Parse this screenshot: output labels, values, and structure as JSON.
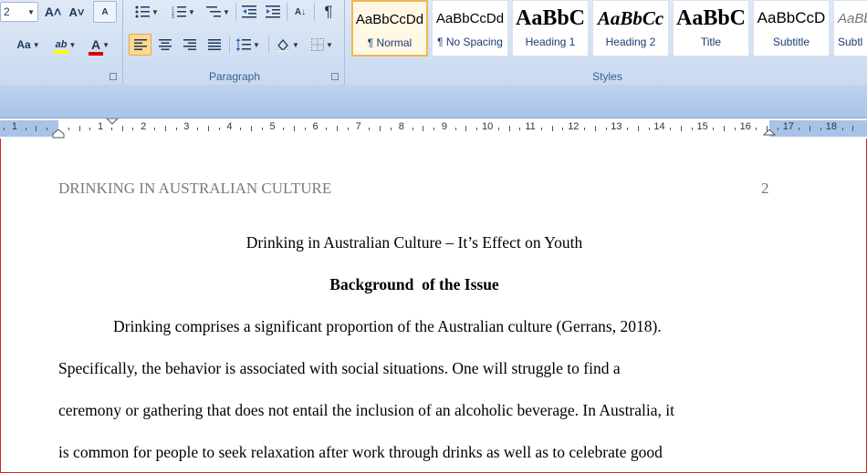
{
  "ribbon": {
    "font_size_value": "2",
    "paragraph_label": "Paragraph",
    "styles_label": "Styles",
    "styles": [
      {
        "preview": "AaBbCcDd",
        "name": "¶ Normal",
        "selected": true
      },
      {
        "preview": "AaBbCcDd",
        "name": "¶ No Spacing",
        "selected": false
      },
      {
        "preview": "AaBbC",
        "name": "Heading 1",
        "selected": false
      },
      {
        "preview": "AaBbCc",
        "name": "Heading 2",
        "selected": false
      },
      {
        "preview": "AaBbC",
        "name": "Title",
        "selected": false
      },
      {
        "preview": "AaBbCcD",
        "name": "Subtitle",
        "selected": false
      },
      {
        "preview": "AaBb",
        "name": "Subtl",
        "selected": false
      }
    ],
    "icons": {
      "grow_font": "A˄",
      "shrink_font": "A˅",
      "clear_format": "A",
      "change_case": "Aa",
      "highlight": "ab",
      "font_color": "A",
      "pilcrow": "¶",
      "sort": "A↓"
    },
    "colors": {
      "highlight": "#ffff00",
      "font_color": "#e00000"
    }
  },
  "ruler": {
    "numbers": [
      "1",
      "1",
      "2",
      "3",
      "4",
      "5",
      "6",
      "7",
      "8",
      "9",
      "10",
      "11",
      "12",
      "13",
      "14",
      "15",
      "16",
      "17",
      "18"
    ]
  },
  "document": {
    "running_head": "DRINKING IN AUSTRALIAN CULTURE",
    "page_number": "2",
    "title": "Drinking in Australian Culture – It’s Effect on Youth",
    "section_heading": "Background  of the Issue",
    "lines": [
      "Drinking comprises a significant proportion of the Australian culture (Gerrans, 2018).",
      "Specifically, the behavior is associated with social situations. One will struggle to find a",
      "ceremony or gathering that does not entail the inclusion of an alcoholic beverage. In Australia, it",
      "is common for people to seek relaxation after work through drinks as well as to celebrate good"
    ]
  }
}
